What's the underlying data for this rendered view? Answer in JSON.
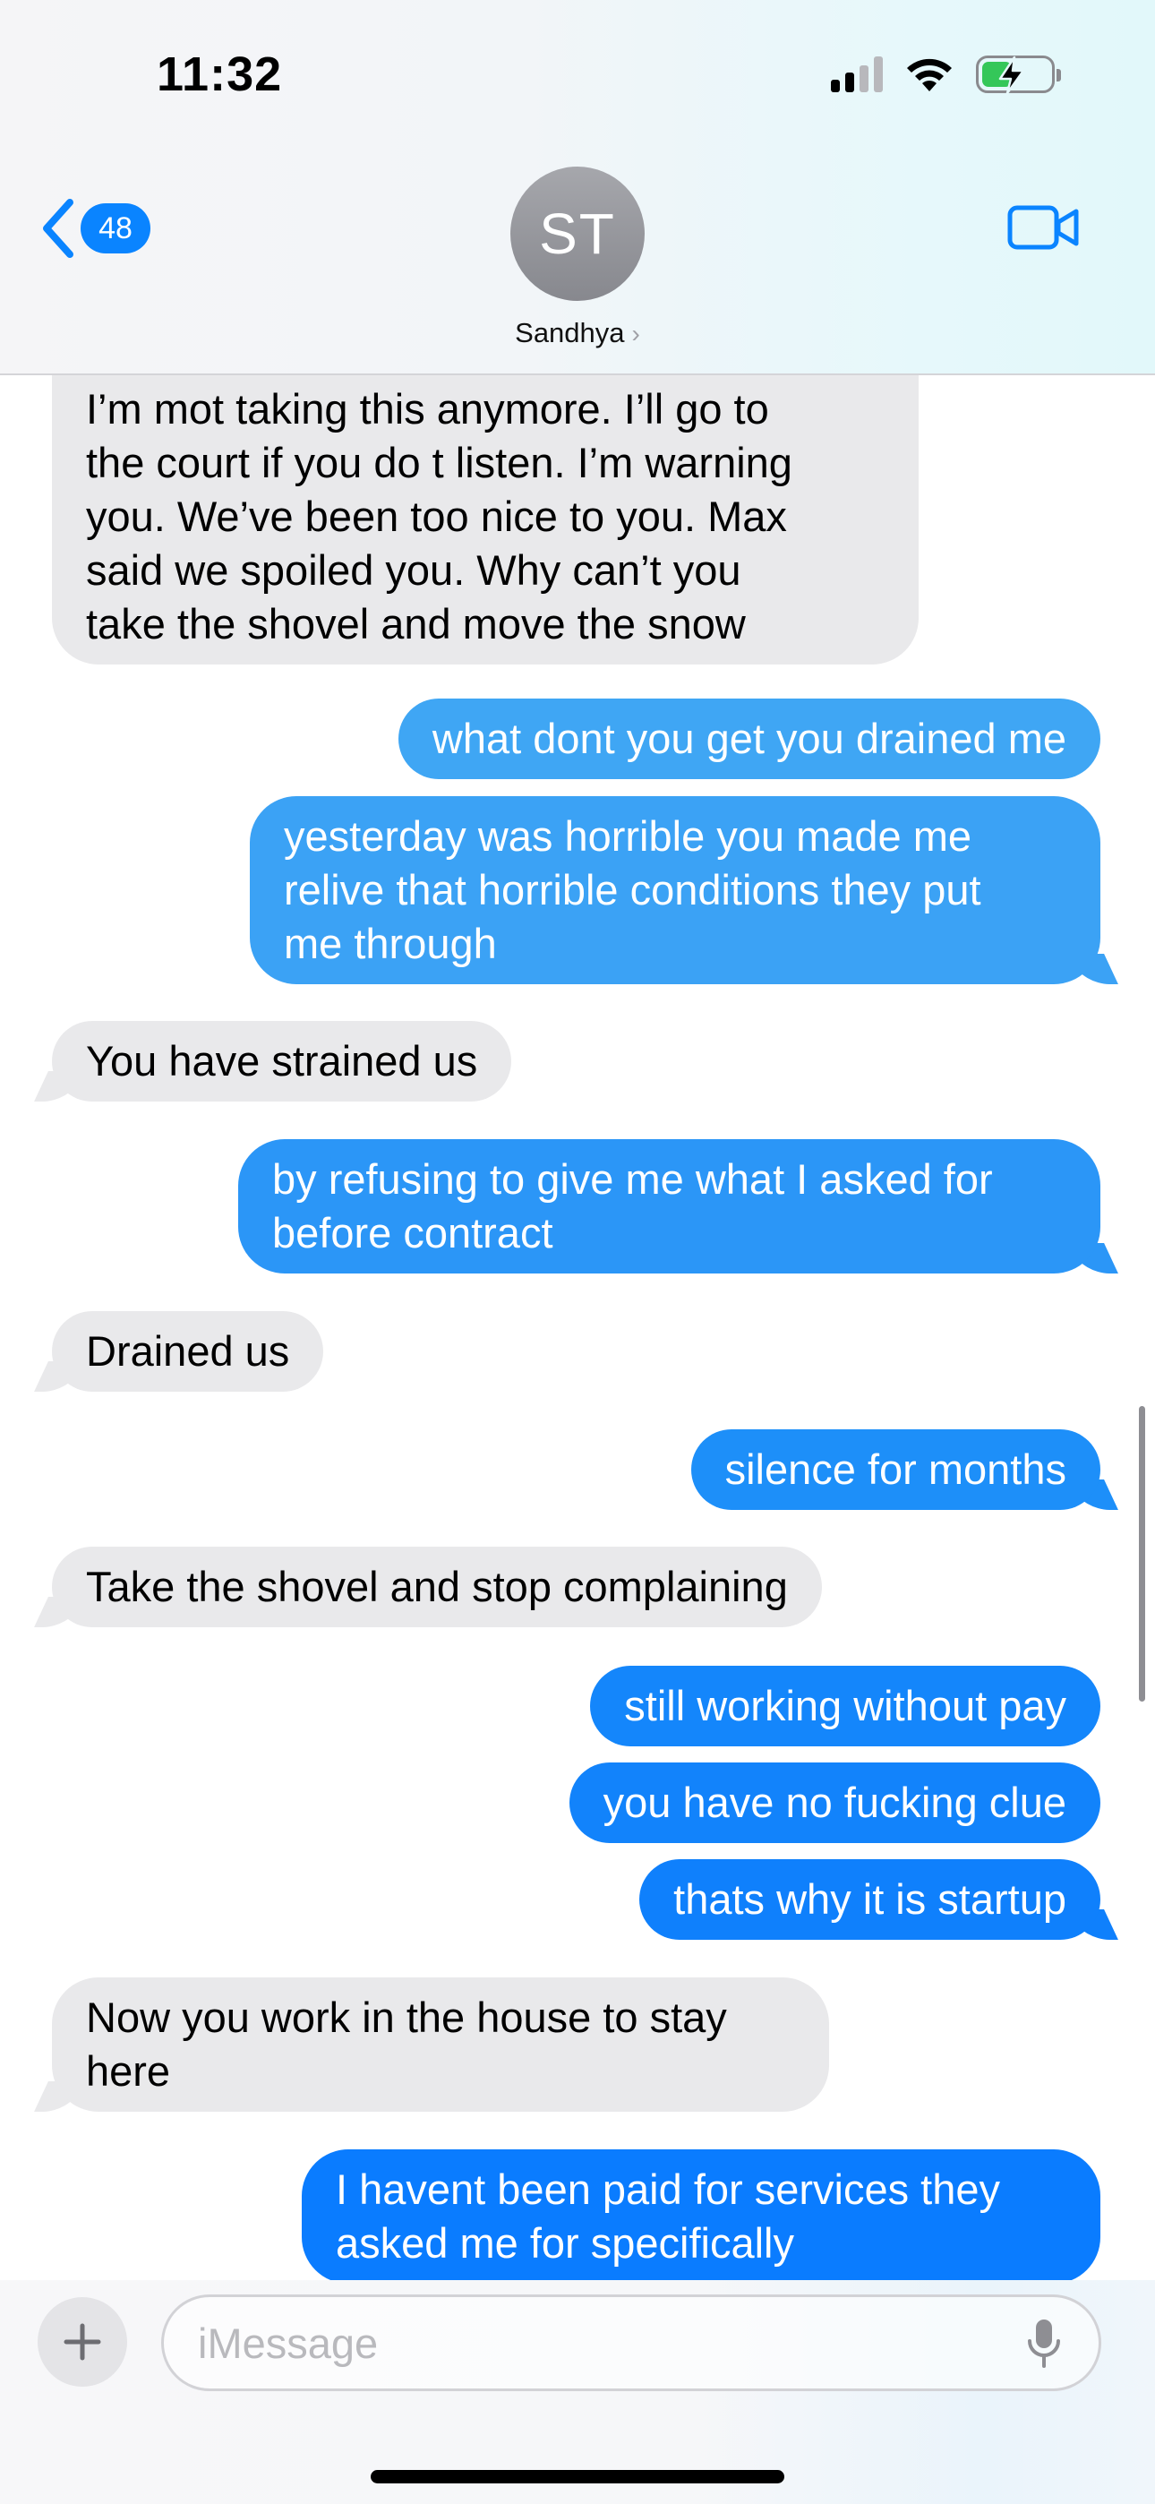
{
  "status_bar": {
    "time": "11:32",
    "battery_level": 0.45,
    "battery_charging": true,
    "signal_bars": 2,
    "colors": {
      "battery": "#34c759"
    }
  },
  "header": {
    "back_count": "48",
    "avatar_initials": "ST",
    "contact_name": "Sandhya",
    "contact_chevron": "›",
    "icons": {
      "back": "chevron-left-icon",
      "video": "video-camera-icon"
    }
  },
  "messages": [
    {
      "from": "them",
      "text": "I’m mot taking this anymore.  I’ll go to\nthe court if you do t listen.  I’m warning\nyou. We’ve been too nice to you.  Max\nsaid we spoiled you.   Why can’t you\ntake the shovel and move the snow"
    },
    {
      "from": "me",
      "text": "what dont you get you drained me"
    },
    {
      "from": "me",
      "text": "yesterday was horrible you made me\nrelive that horrible conditions they put\nme through"
    },
    {
      "from": "them",
      "text": "You have strained us"
    },
    {
      "from": "me",
      "text": "by refusing to give me what I asked for\nbefore contract"
    },
    {
      "from": "them",
      "text": "Drained us"
    },
    {
      "from": "me",
      "text": "silence for months"
    },
    {
      "from": "them",
      "text": "Take the shovel and stop complaining"
    },
    {
      "from": "me",
      "text": "still working without pay"
    },
    {
      "from": "me",
      "text": "you have no fucking clue"
    },
    {
      "from": "me",
      "text": "thats why it is startup"
    },
    {
      "from": "them",
      "text": "Now you work in the house to stay\nhere"
    },
    {
      "from": "me",
      "text": "I havent been paid for services they\nasked me for specifically"
    }
  ],
  "composer": {
    "placeholder": "iMessage",
    "value": "",
    "icons": {
      "add": "plus-icon",
      "mic": "microphone-icon"
    }
  },
  "colors": {
    "received_bubble": "#e9e9eb",
    "sent_bubble_gradient_top": "#3fa7f4",
    "sent_bubble_gradient_bottom": "#0a7cff",
    "accent": "#0a84ff"
  }
}
